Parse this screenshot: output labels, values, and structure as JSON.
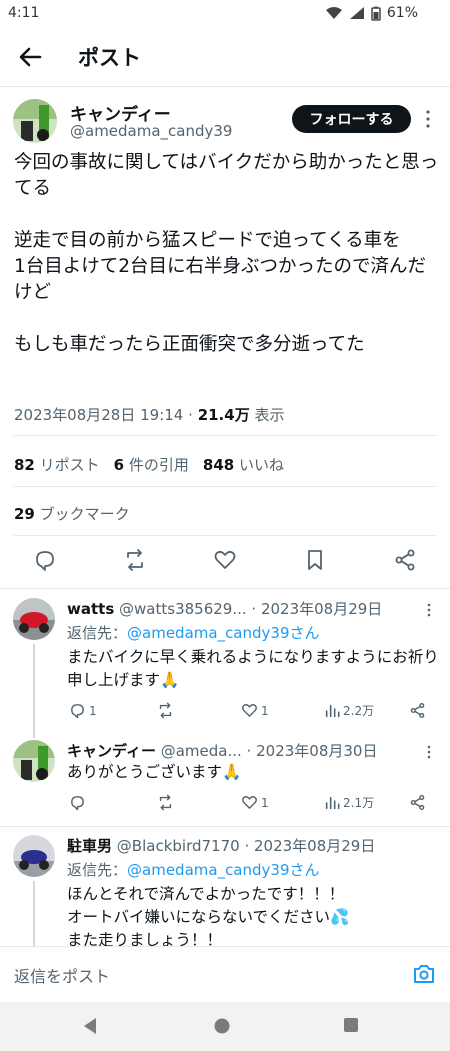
{
  "status": {
    "time": "4:11",
    "battery": "61%"
  },
  "header": {
    "title": "ポスト"
  },
  "post": {
    "name": "キャンディー",
    "handle": "@amedama_candy39",
    "follow_label": "フォローする",
    "text": "今回の事故に関してはバイクだから助かったと思ってる\n\n逆走で目の前から猛スピードで迫ってくる車を\n1台目よけて2台目に右半身ぶつかったので済んだけど\n\nもしも車だったら正面衝突で多分逝ってた",
    "datetime": "2023年08月28日 19:14",
    "views": "21.4万",
    "views_label": "表示",
    "reposts": "82",
    "reposts_label": "リポスト",
    "quotes": "6",
    "quotes_label": "件の引用",
    "likes": "848",
    "likes_label": "いいね",
    "bookmarks": "29",
    "bookmarks_label": "ブックマーク"
  },
  "replies": [
    {
      "name": "watts",
      "handle": "@watts385629...",
      "date": "· 2023年08月29日",
      "reply_to_label": "返信先：",
      "reply_to": "@amedama_candy39さん",
      "text": "またバイクに早く乗れるようになりますようにお祈り申し上げます🙏",
      "replies": "1",
      "likes": "1",
      "views": "2.2万"
    },
    {
      "name": "キャンディー",
      "handle": "@ameda...",
      "date": "· 2023年08月30日",
      "text": "ありがとうございます🙏",
      "replies": "",
      "likes": "1",
      "views": "2.1万"
    },
    {
      "name": "駐車男",
      "handle": "@Blackbird7170",
      "date": "· 2023年08月29日",
      "reply_to_label": "返信先：",
      "reply_to": "@amedama_candy39さん",
      "text": "ほんとそれで済んでよかったです！！！\nオートバイ嫌いにならないでください💦\nまた走りましょう！！"
    }
  ],
  "compose": {
    "placeholder": "返信をポスト"
  }
}
